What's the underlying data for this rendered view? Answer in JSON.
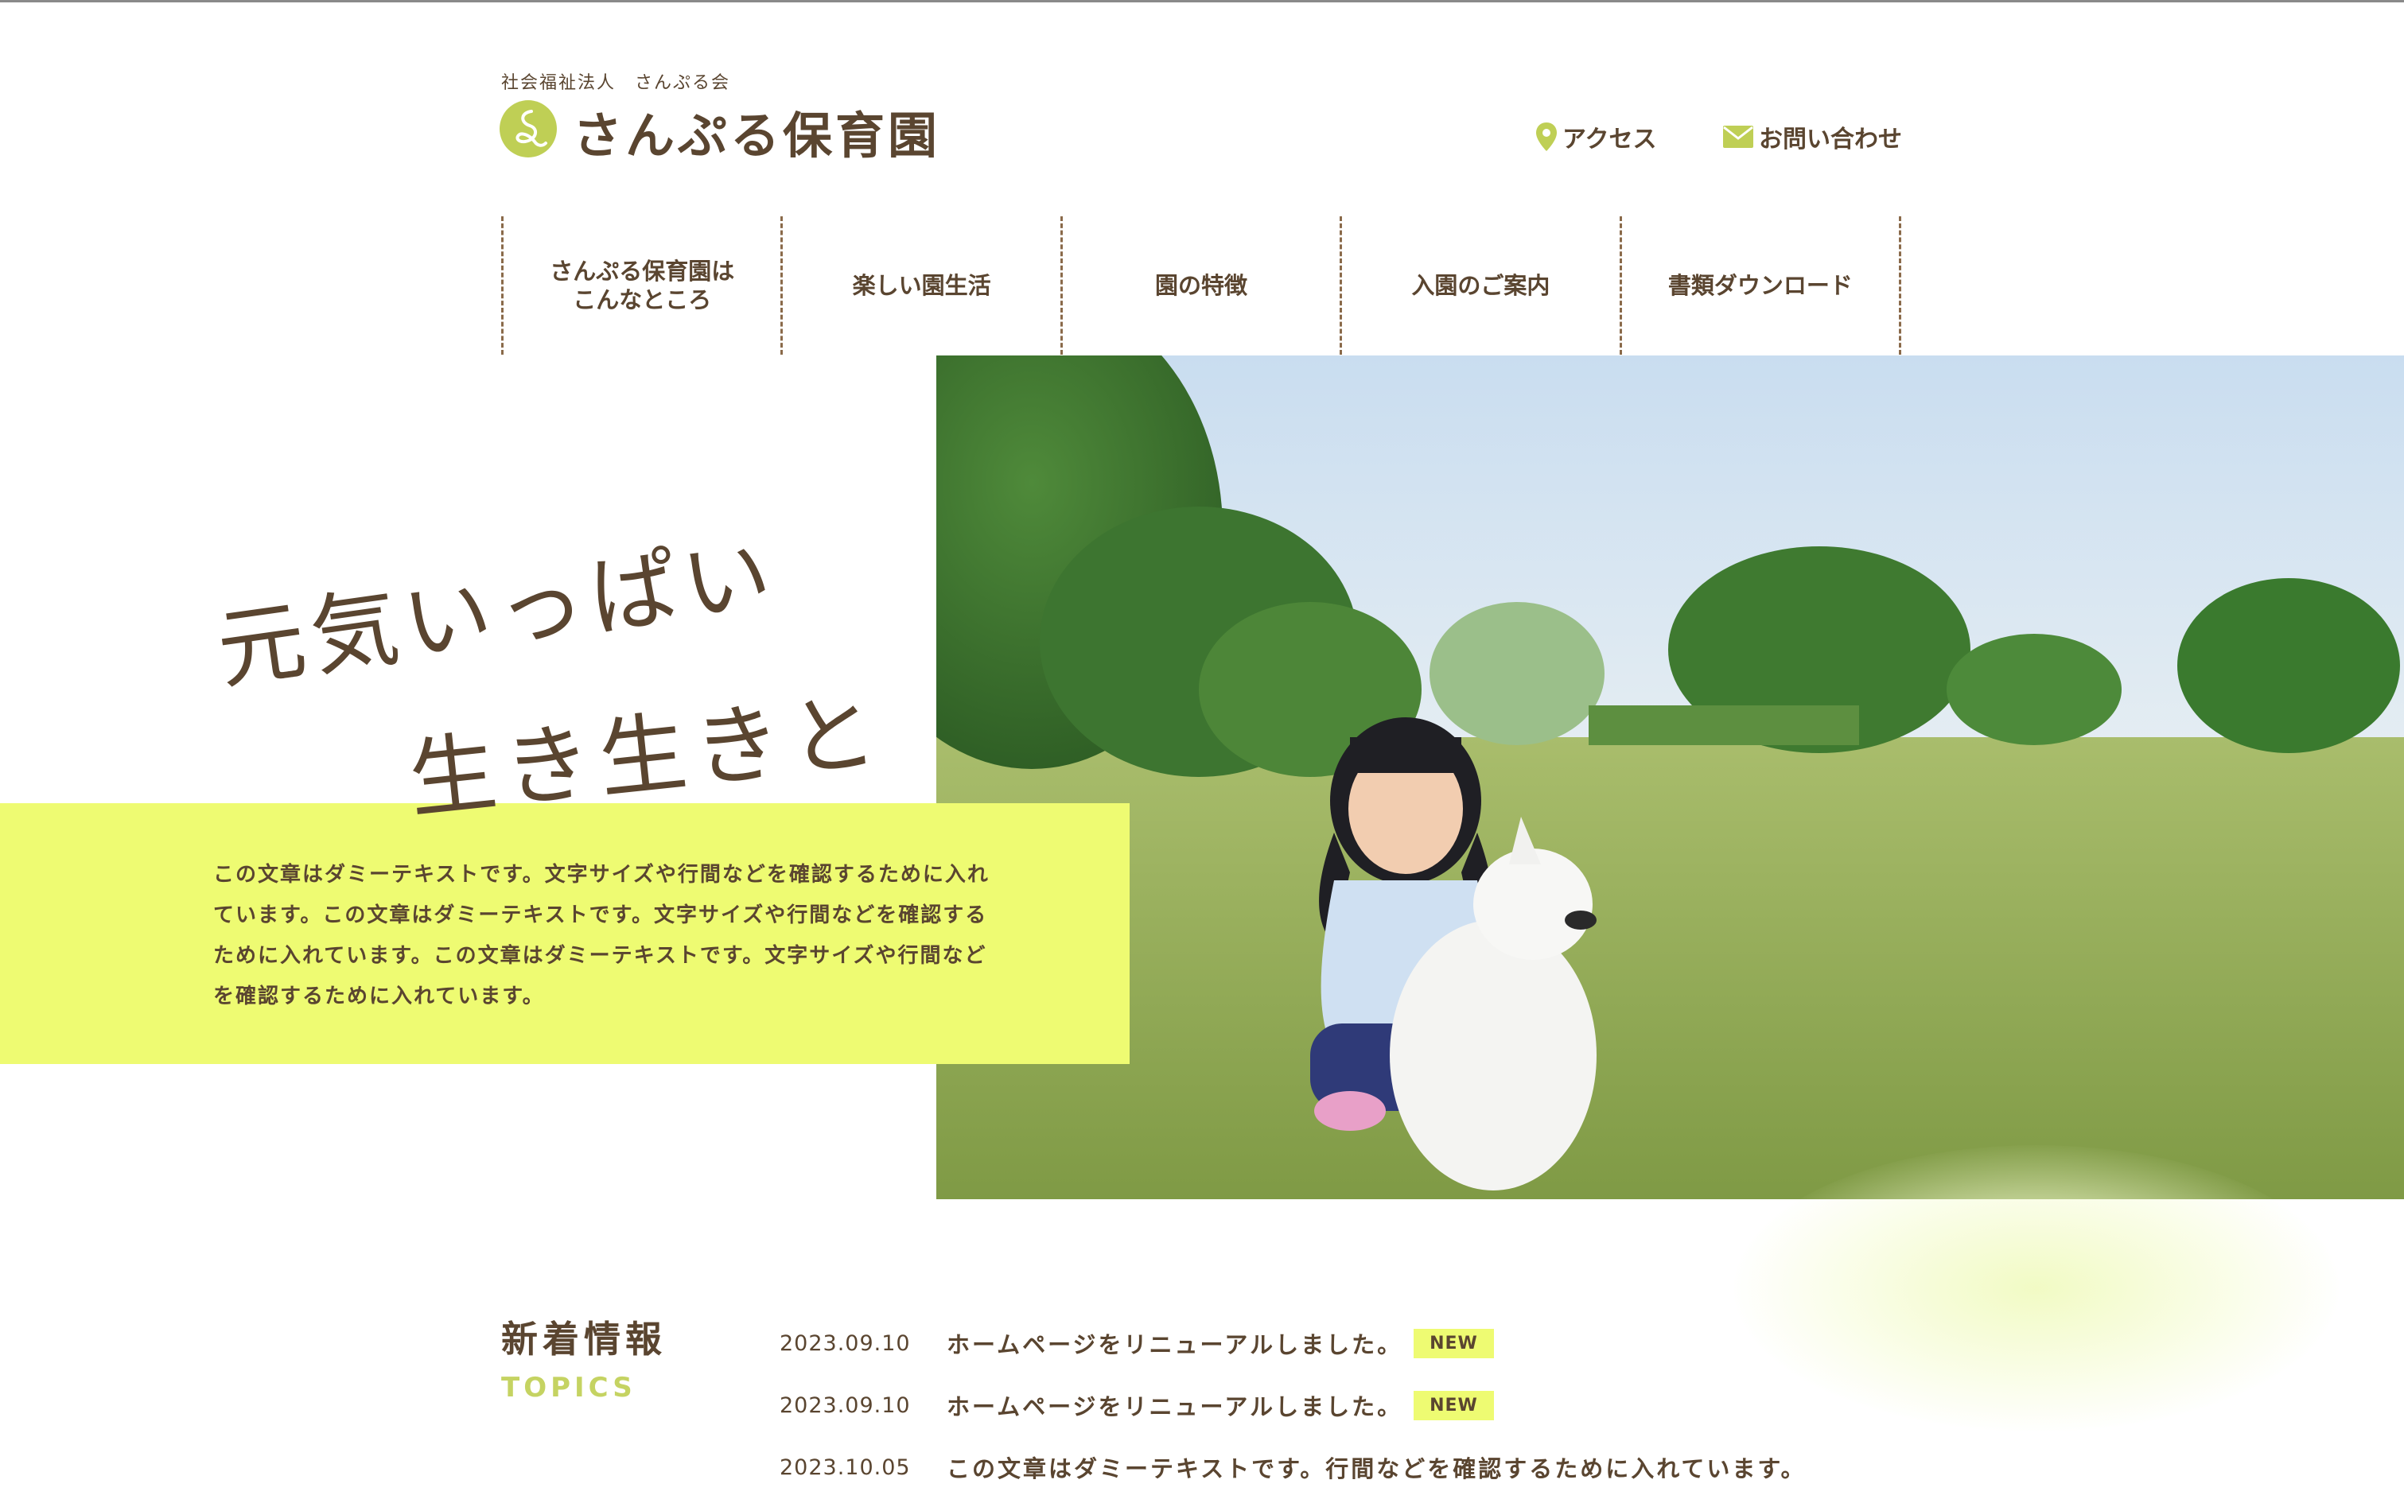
{
  "header": {
    "org_label": "社会福祉法人　さんぷる会",
    "site_title": "さんぷる保育園",
    "access_label": "アクセス",
    "contact_label": "お問い合わせ"
  },
  "nav": {
    "items": [
      {
        "line1": "さんぷる保育園は",
        "line2": "こんなところ"
      },
      {
        "line1": "楽しい園生活"
      },
      {
        "line1": "園の特徴"
      },
      {
        "line1": "入園のご案内"
      },
      {
        "line1": "書類ダウンロード"
      }
    ]
  },
  "hero": {
    "title_line1": "元気いっぱい",
    "title_line2": "生き生きと",
    "body": "この文章はダミーテキストです。文字サイズや行間などを確認するために入れています。この文章はダミーテキストです。文字サイズや行間などを確認するために入れています。この文章はダミーテキストです。文字サイズや行間などを確認するために入れています。"
  },
  "topics": {
    "title": "新着情報",
    "subtitle": "TOPICS",
    "items": [
      {
        "date": "2023.09.10",
        "text": "ホームページをリニューアルしました。",
        "badge": "NEW"
      },
      {
        "date": "2023.09.10",
        "text": "ホームページをリニューアルしました。",
        "badge": "NEW"
      },
      {
        "date": "2023.10.05",
        "text": "この文章はダミーテキストです。行間などを確認するために入れています。",
        "badge": ""
      }
    ]
  },
  "colors": {
    "brand_brown": "#5a4530",
    "accent_lime": "#eefb72",
    "logo_green": "#bfcf55",
    "topics_green": "#c5d362"
  },
  "icons": {
    "logo": "logo-mark-icon",
    "access": "map-pin-icon",
    "contact": "mail-icon"
  }
}
